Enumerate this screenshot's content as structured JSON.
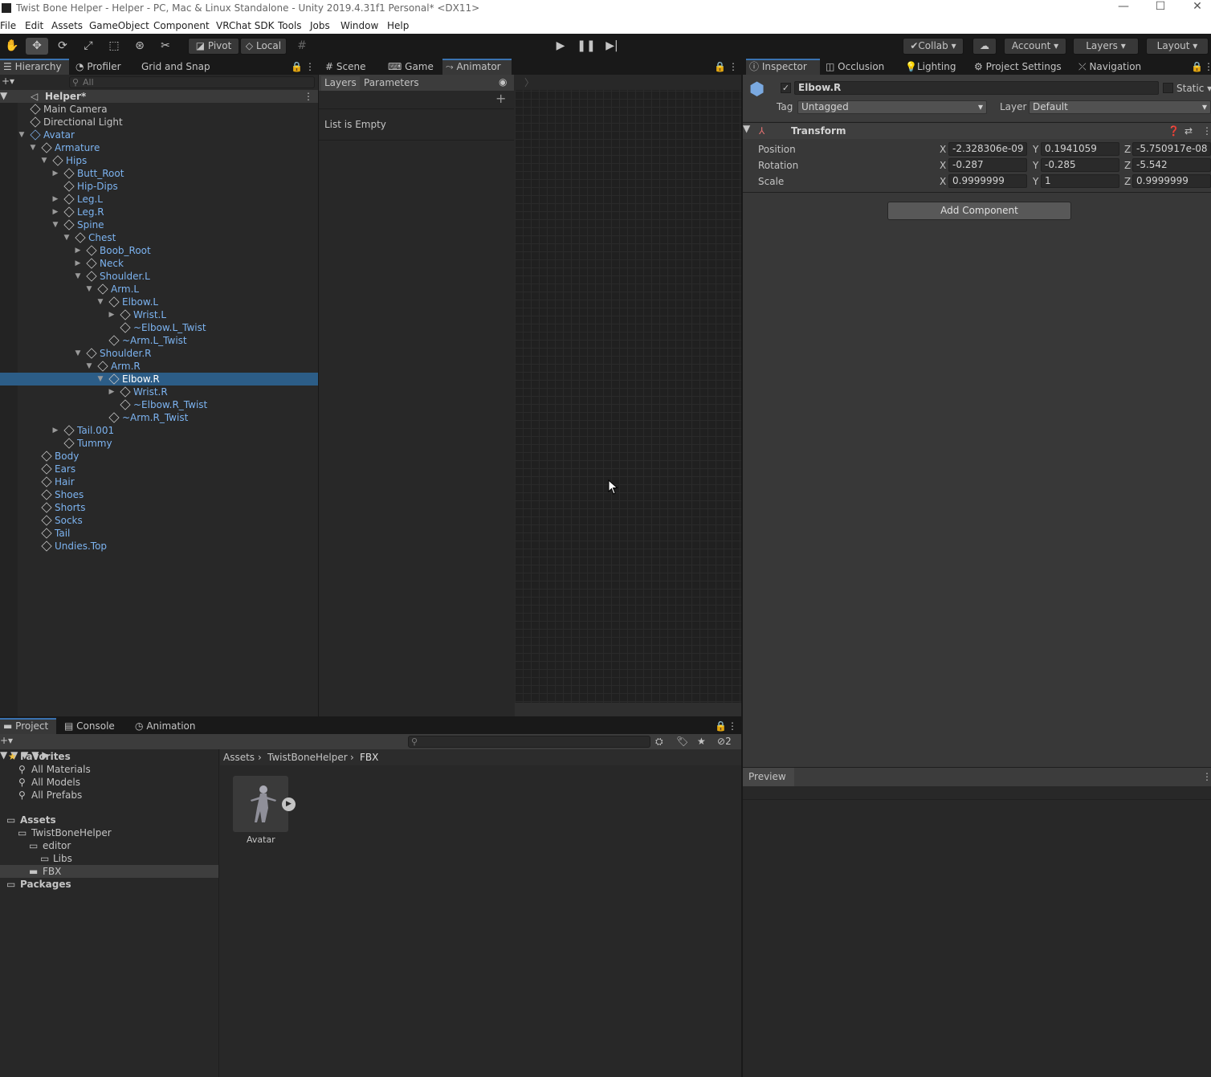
{
  "window": {
    "title": "Twist Bone Helper - Helper - PC, Mac & Linux Standalone - Unity 2019.4.31f1 Personal* <DX11>",
    "minimize": "—",
    "maximize": "☐",
    "close": "✕"
  },
  "menu": [
    "File",
    "Edit",
    "Assets",
    "GameObject",
    "Component",
    "VRChat SDK",
    "Tools",
    "Jobs",
    "Window",
    "Help"
  ],
  "toolbar": {
    "pivot": "Pivot",
    "local": "Local",
    "collab": "Collab",
    "account": "Account",
    "layers": "Layers",
    "layout": "Layout"
  },
  "hierarchy": {
    "tabs": [
      "Hierarchy",
      "Profiler",
      "Grid and Snap"
    ],
    "search_placeholder": "All",
    "scene": "Helper*",
    "rows": [
      {
        "label": "Main Camera",
        "depth": 1,
        "arrow": "",
        "blue": false
      },
      {
        "label": "Directional Light",
        "depth": 1,
        "arrow": "",
        "blue": false
      },
      {
        "label": "Avatar",
        "depth": 1,
        "arrow": "down",
        "blue": true
      },
      {
        "label": "Armature",
        "depth": 2,
        "arrow": "down",
        "blue": true
      },
      {
        "label": "Hips",
        "depth": 3,
        "arrow": "down",
        "blue": true
      },
      {
        "label": "Butt_Root",
        "depth": 4,
        "arrow": "right",
        "blue": true
      },
      {
        "label": "Hip-Dips",
        "depth": 4,
        "arrow": "",
        "blue": true
      },
      {
        "label": "Leg.L",
        "depth": 4,
        "arrow": "right",
        "blue": true
      },
      {
        "label": "Leg.R",
        "depth": 4,
        "arrow": "right",
        "blue": true
      },
      {
        "label": "Spine",
        "depth": 4,
        "arrow": "down",
        "blue": true
      },
      {
        "label": "Chest",
        "depth": 5,
        "arrow": "down",
        "blue": true
      },
      {
        "label": "Boob_Root",
        "depth": 6,
        "arrow": "right",
        "blue": true
      },
      {
        "label": "Neck",
        "depth": 6,
        "arrow": "right",
        "blue": true
      },
      {
        "label": "Shoulder.L",
        "depth": 6,
        "arrow": "down",
        "blue": true
      },
      {
        "label": "Arm.L",
        "depth": 7,
        "arrow": "down",
        "blue": true
      },
      {
        "label": "Elbow.L",
        "depth": 8,
        "arrow": "down",
        "blue": true
      },
      {
        "label": "Wrist.L",
        "depth": 9,
        "arrow": "right",
        "blue": true
      },
      {
        "label": "~Elbow.L_Twist",
        "depth": 9,
        "arrow": "",
        "blue": true
      },
      {
        "label": "~Arm.L_Twist",
        "depth": 8,
        "arrow": "",
        "blue": true
      },
      {
        "label": "Shoulder.R",
        "depth": 6,
        "arrow": "down",
        "blue": true
      },
      {
        "label": "Arm.R",
        "depth": 7,
        "arrow": "down",
        "blue": true
      },
      {
        "label": "Elbow.R",
        "depth": 8,
        "arrow": "down",
        "blue": true,
        "selected": true
      },
      {
        "label": "Wrist.R",
        "depth": 9,
        "arrow": "right",
        "blue": true
      },
      {
        "label": "~Elbow.R_Twist",
        "depth": 9,
        "arrow": "",
        "blue": true
      },
      {
        "label": "~Arm.R_Twist",
        "depth": 8,
        "arrow": "",
        "blue": true
      },
      {
        "label": "Tail.001",
        "depth": 4,
        "arrow": "right",
        "blue": true
      },
      {
        "label": "Tummy",
        "depth": 4,
        "arrow": "",
        "blue": true
      },
      {
        "label": "Body",
        "depth": 2,
        "arrow": "",
        "blue": true
      },
      {
        "label": "Ears",
        "depth": 2,
        "arrow": "",
        "blue": true
      },
      {
        "label": "Hair",
        "depth": 2,
        "arrow": "",
        "blue": true
      },
      {
        "label": "Shoes",
        "depth": 2,
        "arrow": "",
        "blue": true
      },
      {
        "label": "Shorts",
        "depth": 2,
        "arrow": "",
        "blue": true
      },
      {
        "label": "Socks",
        "depth": 2,
        "arrow": "",
        "blue": true
      },
      {
        "label": "Tail",
        "depth": 2,
        "arrow": "",
        "blue": true
      },
      {
        "label": "Undies.Top",
        "depth": 2,
        "arrow": "",
        "blue": true
      }
    ]
  },
  "center": {
    "tabs": [
      "Scene",
      "Game",
      "Animator"
    ],
    "subtabs": [
      "Layers",
      "Parameters"
    ],
    "empty": "List is Empty"
  },
  "inspector": {
    "tabs": [
      "Inspector",
      "Occlusion",
      "Lighting",
      "Project Settings",
      "Navigation"
    ],
    "object_name": "Elbow.R",
    "static_label": "Static",
    "tag_label": "Tag",
    "tag_value": "Untagged",
    "layer_label": "Layer",
    "layer_value": "Default",
    "component": "Transform",
    "position": {
      "label": "Position",
      "x": "-2.328306e-09",
      "y": "0.1941059",
      "z": "-5.750917e-08"
    },
    "rotation": {
      "label": "Rotation",
      "x": "-0.287",
      "y": "-0.285",
      "z": "-5.542"
    },
    "scale": {
      "label": "Scale",
      "x": "0.9999999",
      "y": "1",
      "z": "0.9999999"
    },
    "axis": {
      "x": "X",
      "y": "Y",
      "z": "Z"
    },
    "add_component": "Add Component",
    "preview": "Preview"
  },
  "project": {
    "tabs": [
      "Project",
      "Console",
      "Animation"
    ],
    "favorites": {
      "label": "Favorites",
      "items": [
        "All Materials",
        "All Models",
        "All Prefabs"
      ]
    },
    "tree": {
      "assets": "Assets",
      "twist": "TwistBoneHelper",
      "editor": "editor",
      "libs": "Libs",
      "fbx": "FBX",
      "packages": "Packages"
    },
    "breadcrumb": [
      "Assets",
      "TwistBoneHelper",
      "FBX"
    ],
    "asset": "Avatar",
    "hidden_count": "2"
  }
}
